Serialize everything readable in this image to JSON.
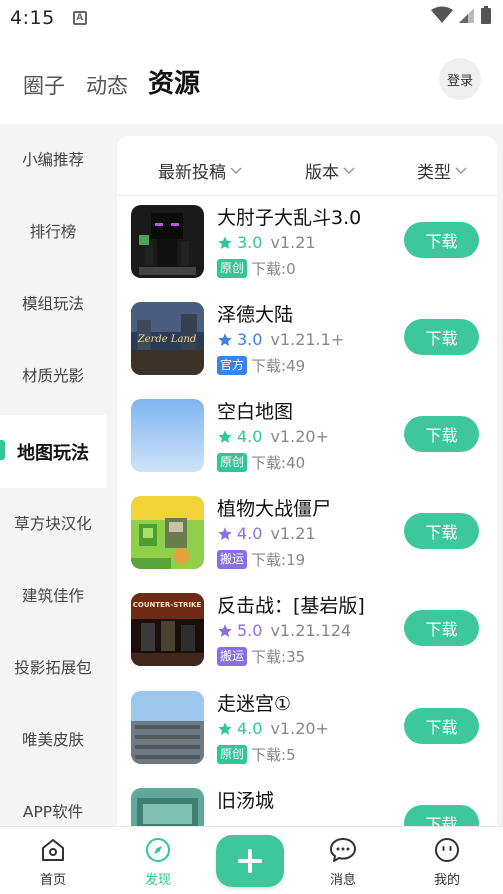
{
  "status_bar": {
    "time": "4:15",
    "notification_letter": "A"
  },
  "header": {
    "tabs": [
      "圈子",
      "动态",
      "资源"
    ],
    "login_label": "登录"
  },
  "sidebar": {
    "items": [
      "小编推荐",
      "排行榜",
      "模组玩法",
      "材质光影",
      "地图玩法",
      "草方块汉化",
      "建筑佳作",
      "投影拓展包",
      "唯美皮肤",
      "APP软件"
    ],
    "active": "地图玩法"
  },
  "filters": [
    "最新投稿",
    "版本",
    "类型"
  ],
  "download_label": "下载",
  "items": [
    {
      "title": "大肘子大乱斗3.0",
      "score": "3.0",
      "version": "v1.21",
      "tag": "原创",
      "downloads": "下载:0",
      "star_color": "#2ec795",
      "tag_color": "#2ec795",
      "icon": "enderman-minecraft-thumbnail"
    },
    {
      "title": "泽德大陆",
      "score": "3.0",
      "version": "v1.21.1+",
      "tag": "官方",
      "downloads": "下载:49",
      "star_color": "#3b82e8",
      "tag_color": "#3b82e8",
      "icon": "zerde-land-thumbnail",
      "thumb_text": "Zerde Land"
    },
    {
      "title": "空白地图",
      "score": "4.0",
      "version": "v1.20+",
      "tag": "原创",
      "downloads": "下载:40",
      "star_color": "#2ec795",
      "tag_color": "#2ec795",
      "icon": "blank-sky-thumbnail"
    },
    {
      "title": "植物大战僵尸",
      "score": "4.0",
      "version": "v1.21",
      "tag": "搬运",
      "downloads": "下载:19",
      "star_color": "#8b6fe0",
      "tag_color": "#8b6fe0",
      "icon": "plants-vs-zombies-thumbnail"
    },
    {
      "title": "反击战：[基岩版]",
      "score": "5.0",
      "version": "v1.21.124",
      "tag": "搬运",
      "downloads": "下载:35",
      "star_color": "#8b6fe0",
      "tag_color": "#8b6fe0",
      "icon": "counter-strike-thumbnail",
      "thumb_text": "COUNTER-STRIKE"
    },
    {
      "title": "走迷宫①",
      "score": "4.0",
      "version": "v1.20+",
      "tag": "原创",
      "downloads": "下载:5",
      "star_color": "#2ec795",
      "tag_color": "#2ec795",
      "icon": "maze-thumbnail"
    },
    {
      "title": "旧汤城",
      "icon": "old-city-thumbnail"
    }
  ],
  "bottom_nav": {
    "items": [
      "首页",
      "发现",
      "消息",
      "我的"
    ],
    "active": "发现",
    "accent": "#2ec795"
  }
}
